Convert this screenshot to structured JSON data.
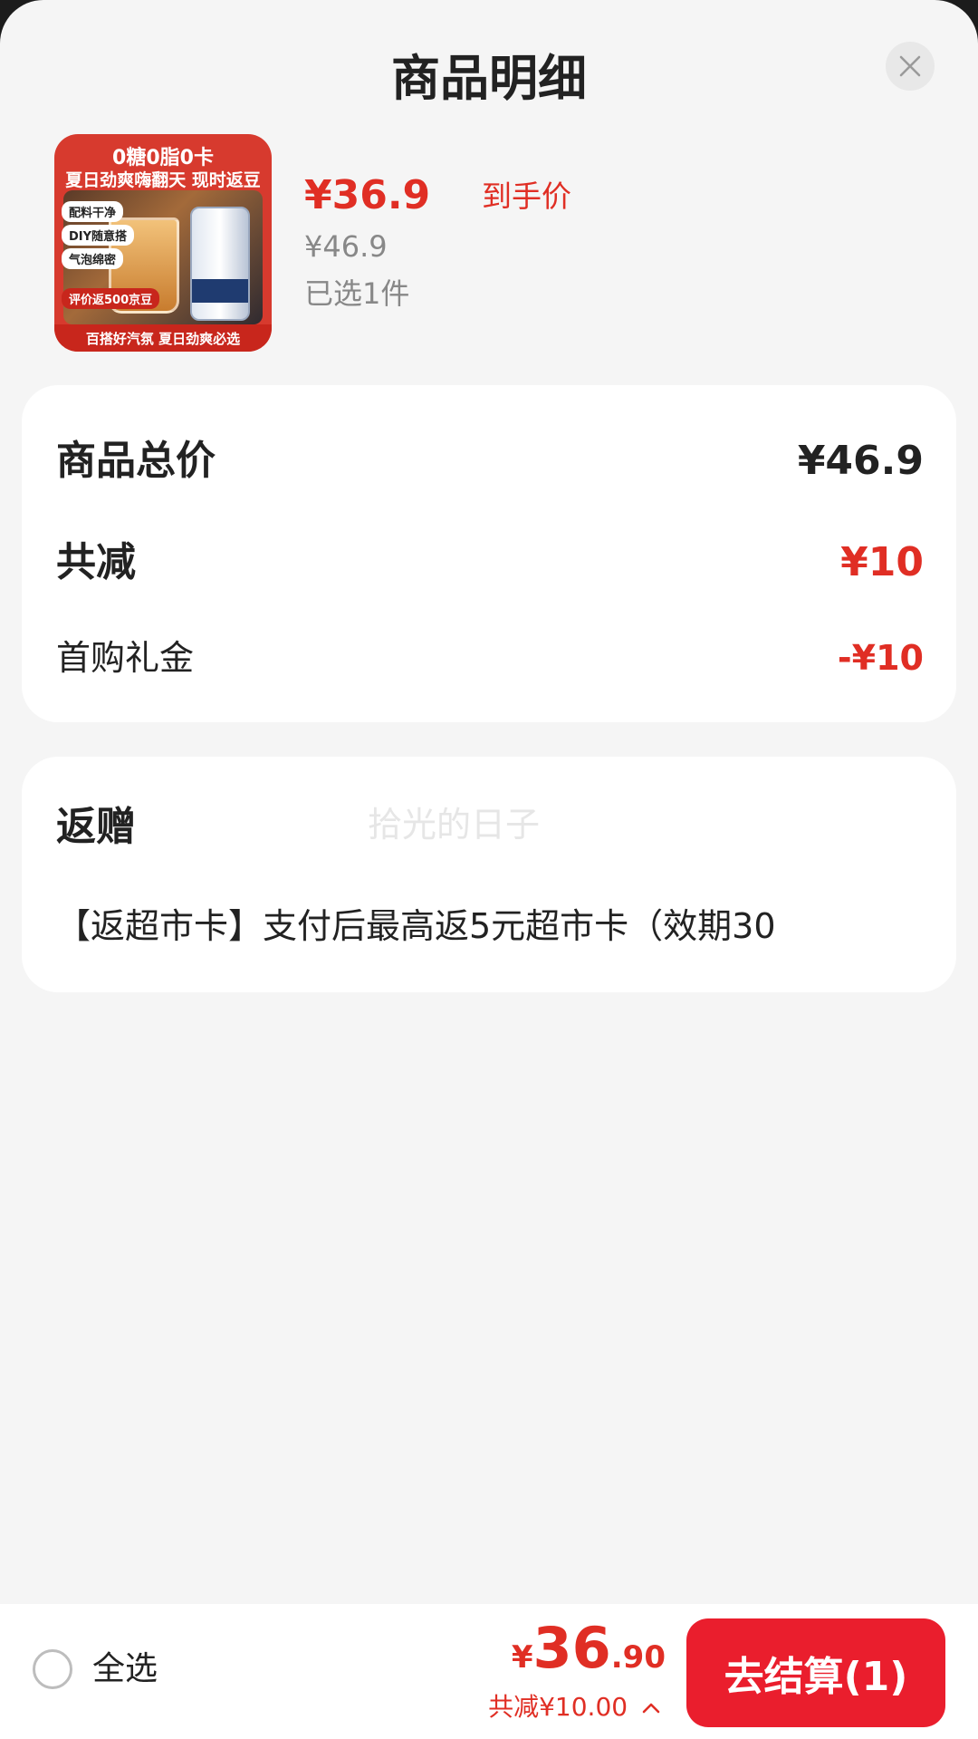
{
  "header": {
    "title": "商品明细"
  },
  "product": {
    "thumb_headline": "0糖0脂0卡",
    "thumb_subline": "夏日劲爽嗨翻天 现时返豆",
    "thumb_tags": [
      "配料干净",
      "DIY随意搭",
      "气泡绵密",
      "评价返500京豆"
    ],
    "thumb_footer": "百搭好汽氛 夏日劲爽必选",
    "price": "¥36.9",
    "price_suffix": "到手价",
    "original_price": "¥46.9",
    "selected_count": "已选1件"
  },
  "summary": {
    "total_label": "商品总价",
    "total_value": "¥46.9",
    "discount_label": "共减",
    "discount_value": "¥10",
    "coupon_label": "首购礼金",
    "coupon_value": "-¥10"
  },
  "rebate": {
    "title": "返赠",
    "watermark": "拾光的日子",
    "description": "【返超市卡】支付后最高返5元超市卡（效期30"
  },
  "bottom_bar": {
    "select_all_label": "全选",
    "total_currency": "¥",
    "total_integer": "36",
    "total_decimal": ".90",
    "saved_text": "共减¥10.00",
    "checkout_label": "去结算(1)"
  },
  "colors": {
    "accent": "#e02e24",
    "checkout": "#ea1e2d",
    "background": "#f5f5f5"
  },
  "icons": {
    "close": "close-icon",
    "collapse": "chevron-up-icon",
    "select": "radio-unchecked-icon"
  }
}
